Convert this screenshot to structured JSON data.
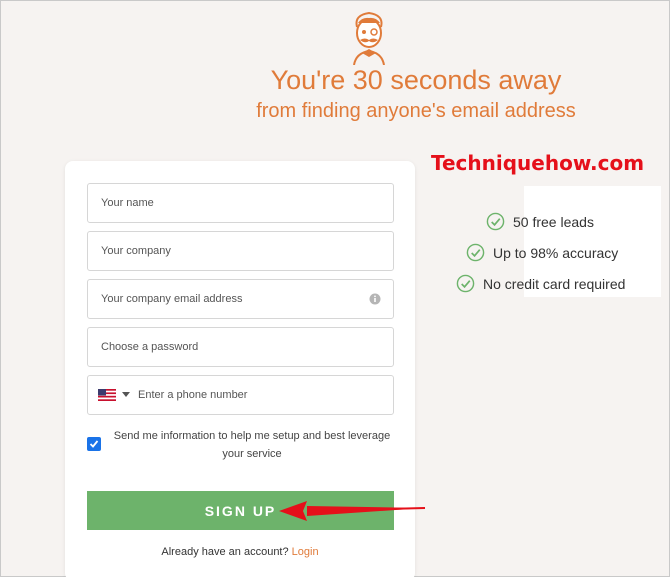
{
  "header": {
    "headline": "You're 30 seconds away",
    "subline": "from finding anyone's email address",
    "mascot_icon": "mustache-man-logo"
  },
  "watermark": "Techniquehow.com",
  "features": [
    {
      "label": "50 free leads",
      "icon": "check-circle-icon"
    },
    {
      "label": "Up to 98% accuracy",
      "icon": "check-circle-icon"
    },
    {
      "label": "No credit card required",
      "icon": "check-circle-icon"
    }
  ],
  "form": {
    "name_placeholder": "Your name",
    "company_placeholder": "Your company",
    "email_placeholder": "Your company email address",
    "password_placeholder": "Choose a password",
    "phone_placeholder": "Enter a phone number",
    "phone_country": "us-flag-icon",
    "consent_text": "Send me information to help me setup and best leverage your service",
    "consent_checked": true,
    "signup_label": "SIGN UP",
    "login_prompt": "Already have an account?",
    "login_link": "Login"
  },
  "colors": {
    "accent": "#e07b3a",
    "button": "#6db36b",
    "check": "#6db36b",
    "annotation_arrow": "#e5101a"
  }
}
